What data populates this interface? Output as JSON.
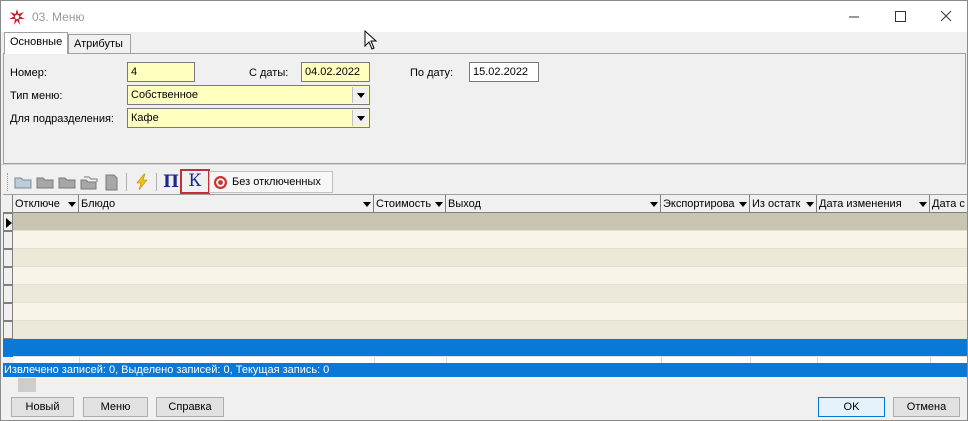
{
  "window": {
    "title": "03. Меню"
  },
  "tabs": [
    {
      "label": "Основные",
      "active": true
    },
    {
      "label": "Атрибуты",
      "active": false
    }
  ],
  "form": {
    "number_label": "Номер:",
    "number_value": "4",
    "date_from_label": "С даты:",
    "date_from_value": "04.02.2022",
    "date_to_label": "По дату:",
    "date_to_value": "15.02.2022",
    "menu_type_label": "Тип меню:",
    "menu_type_value": "Собственное",
    "department_label": "Для подразделения:",
    "department_value": "Кафе"
  },
  "toolbar": {
    "p_label": "П",
    "k_label": "К",
    "filter_label": "Без отключенных"
  },
  "grid": {
    "columns": [
      "Отключе",
      "Блюдо",
      "Стоимость",
      "Выход",
      "Экспортирова",
      "Из остатк",
      "Дата изменения",
      "Дата с"
    ],
    "row_colors": [
      "#c8c6b3",
      "#f8f4e8",
      "#ece9d8",
      "#f8f4e8",
      "#ece9d8",
      "#f8f4e8",
      "#ece9d8",
      "#0a78d7"
    ]
  },
  "status": {
    "text": "Извлечено записей: 0, Выделено записей: 0, Текущая запись: 0"
  },
  "buttons": {
    "new": "Новый",
    "menu": "Меню",
    "help": "Справка",
    "ok": "OK",
    "cancel": "Отмена"
  },
  "colors": {
    "required_field": "#ffffbf",
    "accent": "#0a78d7",
    "highlight_border": "#c0303a"
  }
}
